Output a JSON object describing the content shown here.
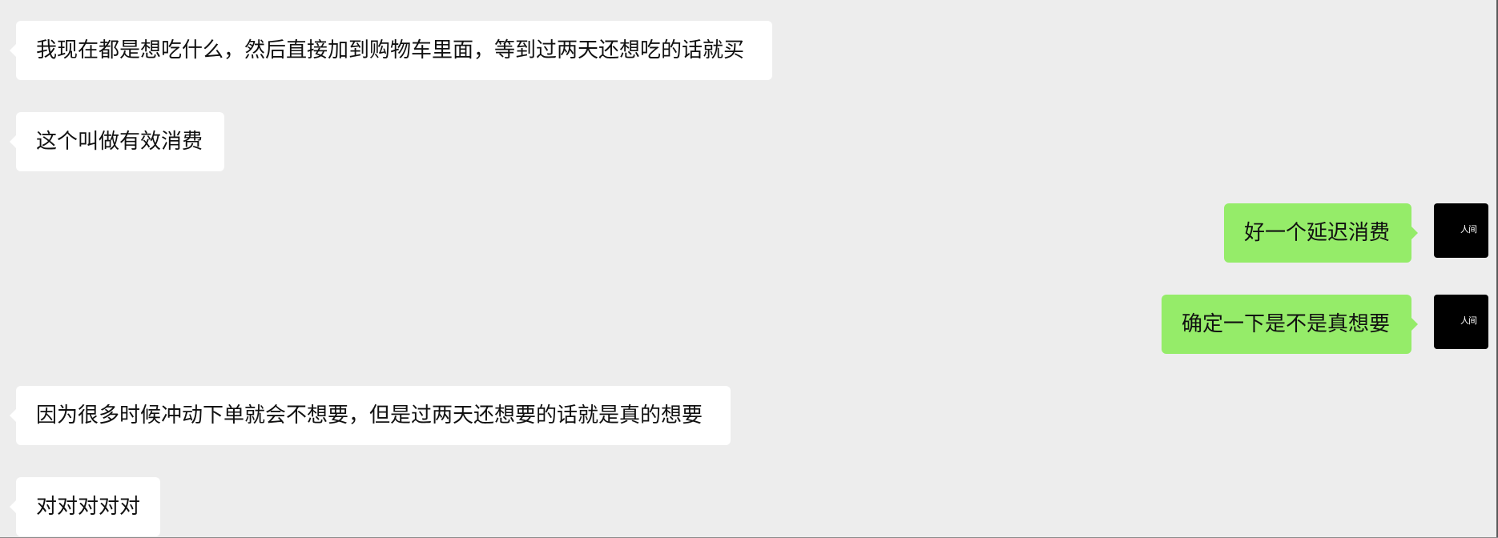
{
  "messages": [
    {
      "side": "left",
      "text": "我现在都是想吃什么，然后直接加到购物车里面，等到过两天还想吃的话就买"
    },
    {
      "side": "left",
      "text": "这个叫做有效消费"
    },
    {
      "side": "right",
      "text": "好一个延迟消费",
      "avatar_text": "人间"
    },
    {
      "side": "right",
      "text": "确定一下是不是真想要",
      "avatar_text": "人间"
    },
    {
      "side": "left",
      "text": "因为很多时候冲动下单就会不想要，但是过两天还想要的话就是真的想要"
    },
    {
      "side": "left",
      "text": "对对对对对"
    }
  ],
  "colors": {
    "background": "#ededed",
    "incoming_bubble": "#ffffff",
    "outgoing_bubble": "#95ec69",
    "avatar": "#000000",
    "text": "#111111"
  }
}
